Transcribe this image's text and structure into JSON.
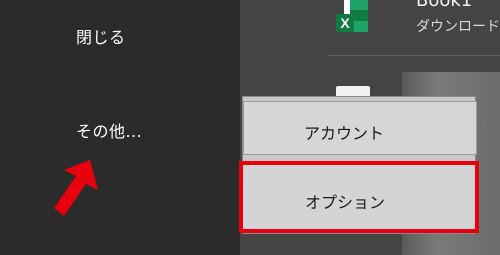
{
  "backstage_menu": {
    "close_label": "閉じる",
    "more_label": "その他..."
  },
  "recent_file": {
    "name": "Book1",
    "subtitle": "ダウンロード"
  },
  "flyout": {
    "account_label": "アカウント",
    "options_label": "オプション"
  },
  "colors": {
    "highlight_border": "#e8000f",
    "arrow": "#e8000f",
    "excel_green": "#107c41"
  }
}
